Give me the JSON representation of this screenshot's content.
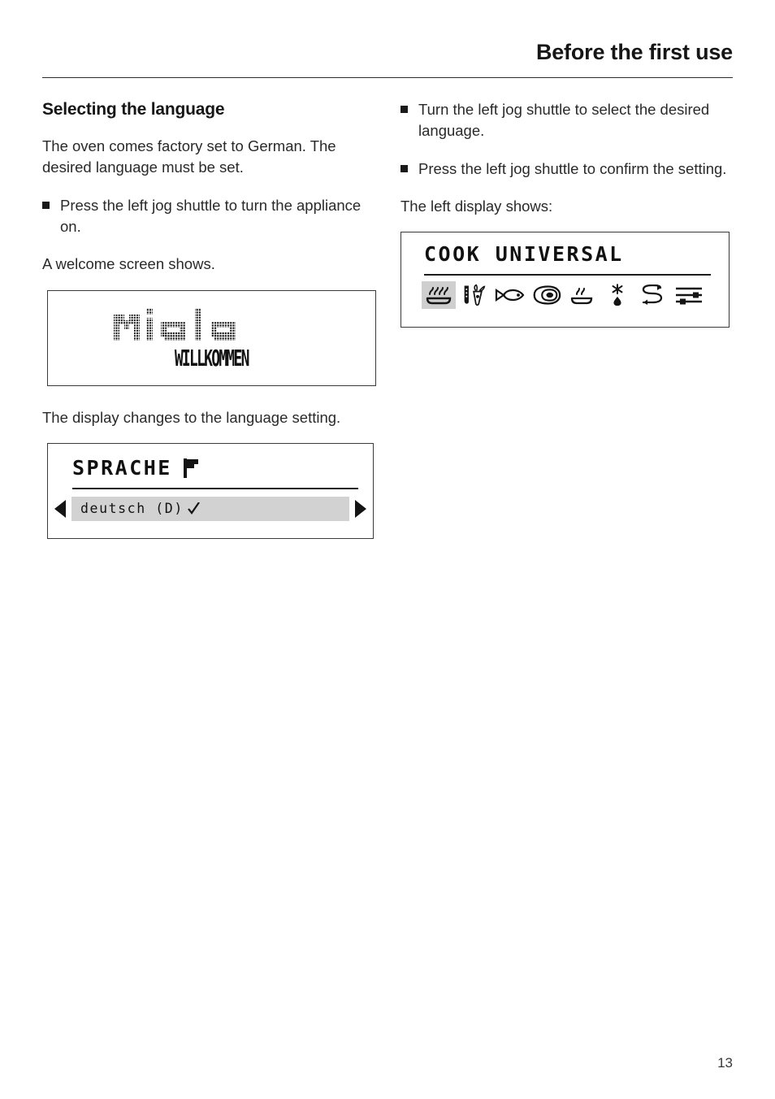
{
  "header": {
    "title": "Before the first use"
  },
  "left_column": {
    "section_title": "Selecting the language",
    "intro": "The oven comes factory set to German. The desired language must be set.",
    "bullet_1": "Press the left jog shuttle to turn the appliance on.",
    "caption_welcome": "A welcome screen shows.",
    "caption_language": "The display changes to the language setting."
  },
  "right_column": {
    "bullet_1": "Turn the left jog shuttle to select the desired language.",
    "bullet_2": "Press the left jog shuttle to confirm the setting.",
    "caption_display": "The left display shows:"
  },
  "welcome_display": {
    "logo_text": "Miele",
    "subtitle": "WILLKOMMEN"
  },
  "sprache_display": {
    "title": "SPRACHE",
    "title_icon": "flag-icon",
    "selected_option": "deutsch (D)",
    "confirm_icon": "check-icon",
    "prev_icon": "arrow-left-icon",
    "next_icon": "arrow-right-icon"
  },
  "cook_display": {
    "title": "COOK UNIVERSAL",
    "icons": [
      {
        "name": "bake-heat-icon",
        "selected": true
      },
      {
        "name": "vegetables-knife-icon",
        "selected": false
      },
      {
        "name": "fish-icon",
        "selected": false
      },
      {
        "name": "meat-roast-icon",
        "selected": false
      },
      {
        "name": "keep-warm-icon",
        "selected": false
      },
      {
        "name": "defrost-icon",
        "selected": false
      },
      {
        "name": "recall-program-icon",
        "selected": false
      },
      {
        "name": "settings-sliders-icon",
        "selected": false
      }
    ]
  },
  "footer": {
    "page_number": "13"
  },
  "colors": {
    "text": "#2a2a2a",
    "heading": "#161616",
    "lcd_border": "#3a3a3a",
    "lcd_highlight": "#d2d2d2",
    "icon_highlight": "#cfcfcf"
  }
}
